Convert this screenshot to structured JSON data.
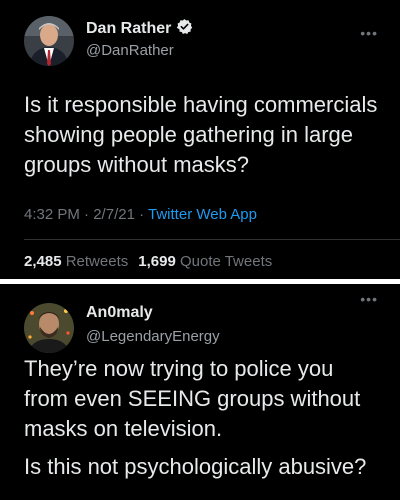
{
  "tweet1": {
    "name": "Dan Rather",
    "handle": "@DanRather",
    "verified": true,
    "text": "Is it responsible having commercials showing people gathering in large groups without masks?",
    "time": "4:32 PM",
    "date": "2/7/21",
    "source": "Twitter Web App",
    "retweets_count": "2,485",
    "retweets_label": "Retweets",
    "quote_count": "1,699",
    "quote_label": "Quote Tweets",
    "more_icon": "more-dots-icon"
  },
  "tweet2": {
    "name": "An0maly",
    "handle": "@LegendaryEnergy",
    "text_line1": "They’re now trying to police you from even SEEING groups without masks on television.",
    "text_line2": "Is this not psychologically abusive?",
    "more_icon": "more-dots-icon"
  },
  "colors": {
    "background": "#000000",
    "text": "#e7e9ea",
    "secondary": "#71767b",
    "link": "#1d9bf0",
    "verified_badge": "#1d9bf0"
  }
}
